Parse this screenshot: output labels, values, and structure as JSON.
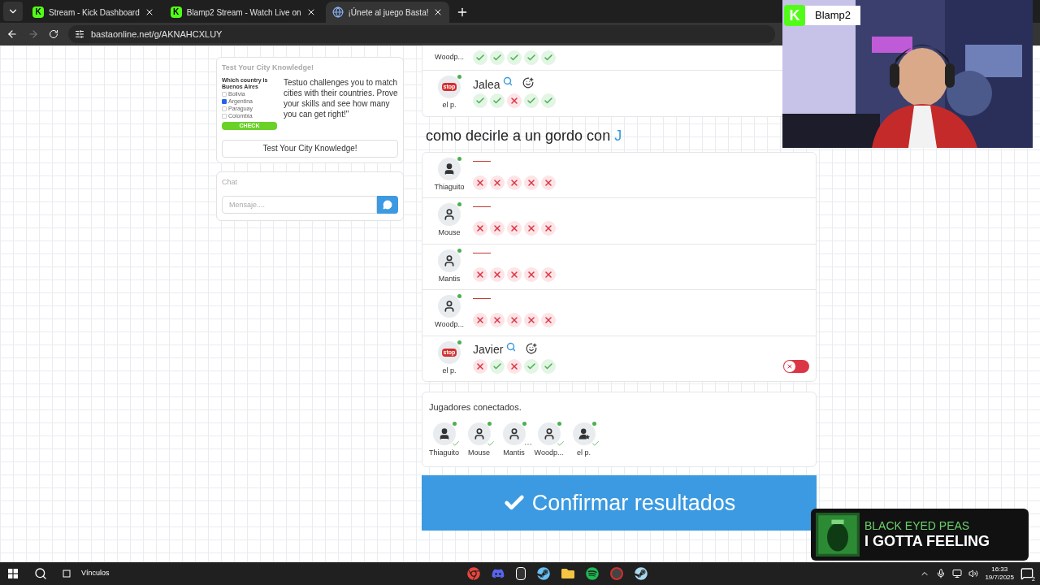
{
  "browser": {
    "tabs": [
      {
        "title": "Stream - Kick Dashboard",
        "kind": "kick",
        "icon_text": "K",
        "selected": false
      },
      {
        "title": "Blamp2 Stream - Watch Live on",
        "kind": "kick",
        "icon_text": "K",
        "selected": false
      },
      {
        "title": "¡Únete al juego Basta!",
        "kind": "globe",
        "selected": true
      }
    ],
    "address": "bastaonline.net/g/AKNAHCXLUY"
  },
  "sidebar": {
    "ad": {
      "title": "Test Your City Knowledge!",
      "quiz_question": "Which country is Buenos Aires",
      "quiz_options": [
        {
          "label": "Bolivia",
          "checked": false
        },
        {
          "label": "Argentina",
          "checked": true
        },
        {
          "label": "Paraguay",
          "checked": false
        },
        {
          "label": "Colombia",
          "checked": false
        }
      ],
      "quiz_button": "CHECK",
      "description": "Testuo challenges you to match cities with their countries. Prove your skills and see how many you can get right!\"",
      "button": "Test Your City Knowledge!"
    },
    "chat": {
      "title": "Chat",
      "placeholder": "Mensaje...."
    }
  },
  "previous_category": {
    "rows": [
      {
        "player": "Woodp...",
        "kind": "cut",
        "votes": [
          true,
          true,
          true,
          true,
          true
        ]
      },
      {
        "player": "el p.",
        "avatar": {
          "kind": "stop",
          "label": "stop"
        },
        "kind": "text",
        "answer": "Jalea",
        "votes": [
          true,
          true,
          false,
          true,
          true
        ]
      }
    ]
  },
  "category": {
    "prompt": "como decirle a un gordo con",
    "letter": "J",
    "rows": [
      {
        "player": "Thiaguito",
        "avatar": {
          "kind": "user"
        },
        "kind": "empty",
        "votes": [
          false,
          false,
          false,
          false,
          false
        ]
      },
      {
        "player": "Mouse",
        "avatar": {
          "kind": "user-outline"
        },
        "kind": "empty",
        "votes": [
          false,
          false,
          false,
          false,
          false
        ]
      },
      {
        "player": "Mantis",
        "avatar": {
          "kind": "user-outline"
        },
        "kind": "empty",
        "votes": [
          false,
          false,
          false,
          false,
          false
        ]
      },
      {
        "player": "Woodp...",
        "avatar": {
          "kind": "user-outline"
        },
        "kind": "empty",
        "votes": [
          false,
          false,
          false,
          false,
          false
        ]
      },
      {
        "player": "el p.",
        "avatar": {
          "kind": "stop",
          "label": "stop"
        },
        "kind": "text",
        "answer": "Javier",
        "votes": [
          false,
          true,
          false,
          true,
          true
        ],
        "toggle": {
          "on": false
        }
      }
    ]
  },
  "connected": {
    "title": "Jugadores conectados.",
    "players": [
      {
        "name": "Thiaguito",
        "avatar": {
          "kind": "user"
        },
        "typing": false
      },
      {
        "name": "Mouse",
        "avatar": {
          "kind": "user-outline"
        },
        "typing": false
      },
      {
        "name": "Mantis",
        "avatar": {
          "kind": "user-outline"
        },
        "typing": true
      },
      {
        "name": "Woodp...",
        "avatar": {
          "kind": "user-outline"
        },
        "typing": false
      },
      {
        "name": "el p.",
        "avatar": {
          "kind": "user-star"
        },
        "typing": false
      }
    ]
  },
  "confirm_button": "Confirmar resultados",
  "webcam": {
    "logo": "K",
    "name": "Blamp2"
  },
  "now_playing": {
    "artist": "BLACK EYED PEAS",
    "song": "I GOTTA FEELING"
  },
  "taskbar": {
    "links_label": "Vínculos",
    "time": "16:33",
    "date": "19/7/2025",
    "notifications": "2"
  }
}
